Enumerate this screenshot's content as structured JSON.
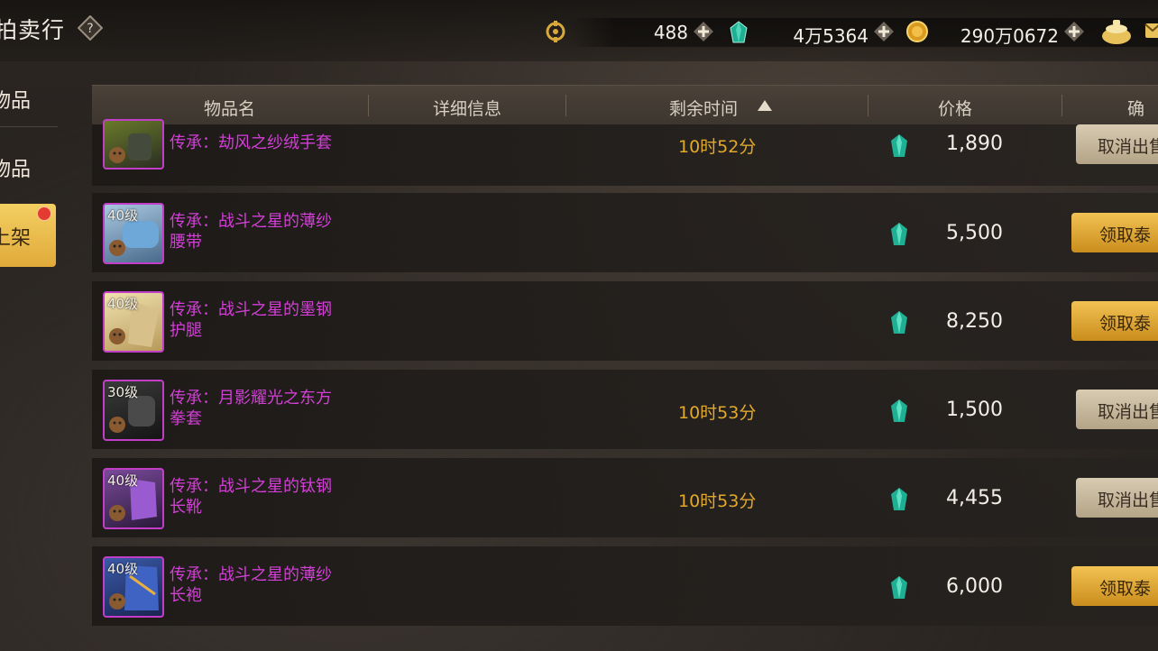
{
  "header": {
    "title": "拍卖行",
    "resources": [
      {
        "icon": "token-icon",
        "value": "488"
      },
      {
        "icon": "jade-gem-icon",
        "value": "4万5364"
      },
      {
        "icon": "gold-coin-icon",
        "value": "290万0672"
      }
    ]
  },
  "sidebar": {
    "tabs": [
      {
        "label": "物品"
      },
      {
        "label": "物品"
      },
      {
        "label": "上架"
      }
    ]
  },
  "table": {
    "columns": [
      "物品名",
      "详细信息",
      "剩余时间",
      "价格",
      "确认"
    ],
    "rows": [
      {
        "level": "",
        "name_line1": "传承：劫风之纱绒手套",
        "name_line2": "",
        "time": "10时52分",
        "price": "1,890",
        "action": "取消出售"
      },
      {
        "level": "40级",
        "name_line1": "传承：战斗之星的薄纱",
        "name_line2": "腰带",
        "time": "",
        "price": "5,500",
        "action": "领取泰"
      },
      {
        "level": "40级",
        "name_line1": "传承：战斗之星的墨钢",
        "name_line2": "护腿",
        "time": "",
        "price": "8,250",
        "action": "领取泰"
      },
      {
        "level": "30级",
        "name_line1": "传承：月影耀光之东方",
        "name_line2": "拳套",
        "time": "10时53分",
        "price": "1,500",
        "action": "取消出售"
      },
      {
        "level": "40级",
        "name_line1": "传承：战斗之星的钛钢",
        "name_line2": "长靴",
        "time": "10时53分",
        "price": "4,455",
        "action": "取消出售"
      },
      {
        "level": "40级",
        "name_line1": "传承：战斗之星的薄纱",
        "name_line2": "长袍",
        "time": "",
        "price": "6,000",
        "action": "领取泰"
      }
    ]
  },
  "colors": {
    "item_name": "#d33fd6",
    "time": "#e3a92a",
    "claim_button": "#e0aa3a",
    "cancel_button": "#c8bb9f"
  }
}
